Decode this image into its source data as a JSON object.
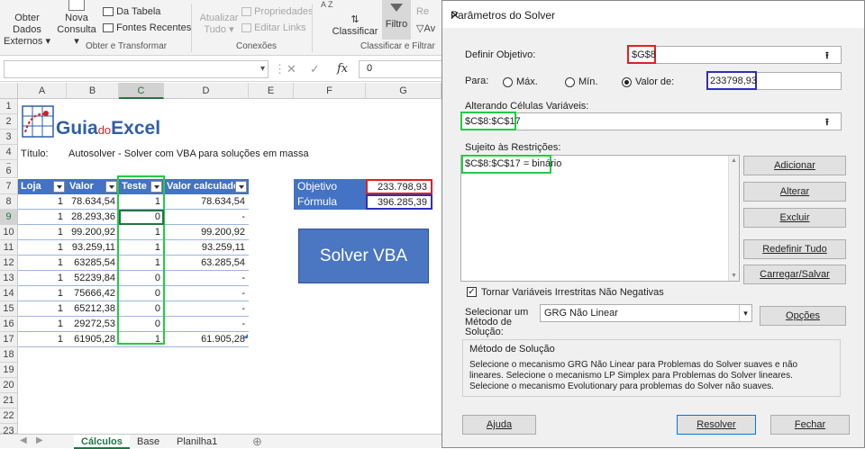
{
  "ribbon": {
    "obter_dados": "Obter Dados",
    "externos": "Externos",
    "nova": "Nova",
    "consulta": "Consulta",
    "da_tabela": "Da Tabela",
    "fontes_recentes": "Fontes Recentes",
    "group_obter": "Obter e Transformar",
    "atualizar": "Atualizar",
    "tudo": "Tudo",
    "propriedades": "Propriedades",
    "editar_links": "Editar Links",
    "group_conexoes": "Conexões",
    "classificar": "Classificar",
    "filtro": "Filtro",
    "group_classificar": "Classificar e Filtrar",
    "re": "Re",
    "av": "Av"
  },
  "formula_bar": {
    "value": "0"
  },
  "columns": [
    "A",
    "B",
    "C",
    "D",
    "E",
    "F",
    "G"
  ],
  "rows": [
    "1",
    "2",
    "3",
    "4",
    "5",
    "6",
    "7",
    "8",
    "9",
    "10",
    "11",
    "12",
    "13",
    "14",
    "15",
    "16",
    "17",
    "18",
    "19",
    "20",
    "21",
    "22",
    "23"
  ],
  "sheet": {
    "logo_guia": "Guia",
    "logo_do": "do",
    "logo_excel": "Excel",
    "titulo_label": "Título:",
    "titulo_value": "Autosolver - Solver com VBA para soluções em massa",
    "table_headers": [
      "Loja",
      "Valor",
      "Teste",
      "Valor calculado"
    ],
    "table_rows": [
      [
        "1",
        "78.634,54",
        "1",
        "78.634,54"
      ],
      [
        "1",
        "28.293,36",
        "0",
        "-"
      ],
      [
        "1",
        "99.200,92",
        "1",
        "99.200,92"
      ],
      [
        "1",
        "93.259,11",
        "1",
        "93.259,11"
      ],
      [
        "1",
        "63285,54",
        "1",
        "63.285,54"
      ],
      [
        "1",
        "52239,84",
        "0",
        "-"
      ],
      [
        "1",
        "75666,42",
        "0",
        "-"
      ],
      [
        "1",
        "65212,38",
        "0",
        "-"
      ],
      [
        "1",
        "29272,53",
        "0",
        "-"
      ],
      [
        "1",
        "61905,28",
        "1",
        "61.905,28"
      ]
    ],
    "objetivo_label": "Objetivo",
    "objetivo_value": "233.798,93",
    "formula_label": "Fórmula",
    "formula_value": "396.285,39",
    "solver_button": "Solver VBA"
  },
  "tabs": [
    "Cálculos",
    "Base",
    "Planilha1"
  ],
  "dialog": {
    "title": "Parâmetros do Solver",
    "definir_objetivo": "Definir Objetivo:",
    "objetivo_ref": "$G$8",
    "para": "Para:",
    "max": "Máx.",
    "min": "Mín.",
    "valor_de": "Valor de:",
    "valor_de_value": "233798,93",
    "alterando": "Alterando Células Variáveis:",
    "alterando_value": "$C$8:$C$17",
    "sujeito": "Sujeito às Restrições:",
    "restricao": "$C$8:$C$17 = binário",
    "adicionar": "Adicionar",
    "alterar": "Alterar",
    "excluir": "Excluir",
    "redefinir": "Redefinir Tudo",
    "carregar": "Carregar/Salvar",
    "tornar": "Tornar Variáveis Irrestritas Não Negativas",
    "selecionar_1": "Selecionar um",
    "selecionar_2": "Método de",
    "selecionar_3": "Solução:",
    "metodo_value": "GRG Não Linear",
    "opcoes": "Opções",
    "metodo_title": "Método de Solução",
    "metodo_desc": "Selecione o mecanismo GRG Não Linear para Problemas do Solver suaves e não lineares. Selecione o mecanismo LP Simplex para Problemas do Solver lineares. Selecione o mecanismo Evolutionary para problemas do Solver não suaves.",
    "ajuda": "Ajuda",
    "resolver": "Resolver",
    "fechar": "Fechar"
  }
}
